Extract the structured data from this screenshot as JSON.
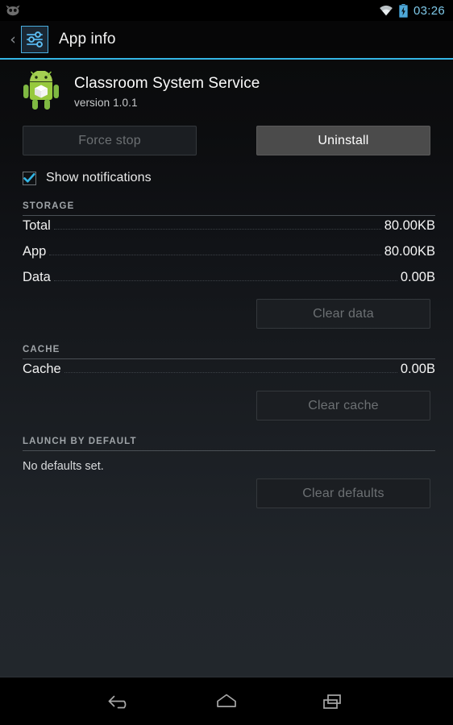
{
  "status_bar": {
    "notification_icon": "cyanogenmod-head-icon",
    "wifi_icon": "wifi-icon",
    "battery_icon": "battery-charging-icon",
    "clock": "03:26",
    "clock_color": "#7ec8e8"
  },
  "action_bar": {
    "back_chevron": "‹",
    "icon": "settings-sliders-icon",
    "title": "App info",
    "accent_color": "#33b5e5"
  },
  "app": {
    "icon": "android-robot-icon",
    "name": "Classroom System Service",
    "version": "version 1.0.1"
  },
  "actions": {
    "force_stop": {
      "label": "Force stop",
      "enabled": false
    },
    "uninstall": {
      "label": "Uninstall",
      "enabled": true
    }
  },
  "notifications": {
    "label": "Show notifications",
    "checked": true,
    "check_color": "#33b5e5"
  },
  "sections": {
    "storage": {
      "title": "STORAGE",
      "rows": [
        {
          "label": "Total",
          "value": "80.00KB"
        },
        {
          "label": "App",
          "value": "80.00KB"
        },
        {
          "label": "Data",
          "value": "0.00B"
        }
      ],
      "button": {
        "label": "Clear data",
        "enabled": false
      }
    },
    "cache": {
      "title": "CACHE",
      "rows": [
        {
          "label": "Cache",
          "value": "0.00B"
        }
      ],
      "button": {
        "label": "Clear cache",
        "enabled": false
      }
    },
    "launch_by_default": {
      "title": "LAUNCH BY DEFAULT",
      "note": "No defaults set.",
      "button": {
        "label": "Clear defaults",
        "enabled": false
      }
    }
  },
  "nav_bar": {
    "back": "back-icon",
    "home": "home-icon",
    "recents": "recent-apps-icon"
  }
}
